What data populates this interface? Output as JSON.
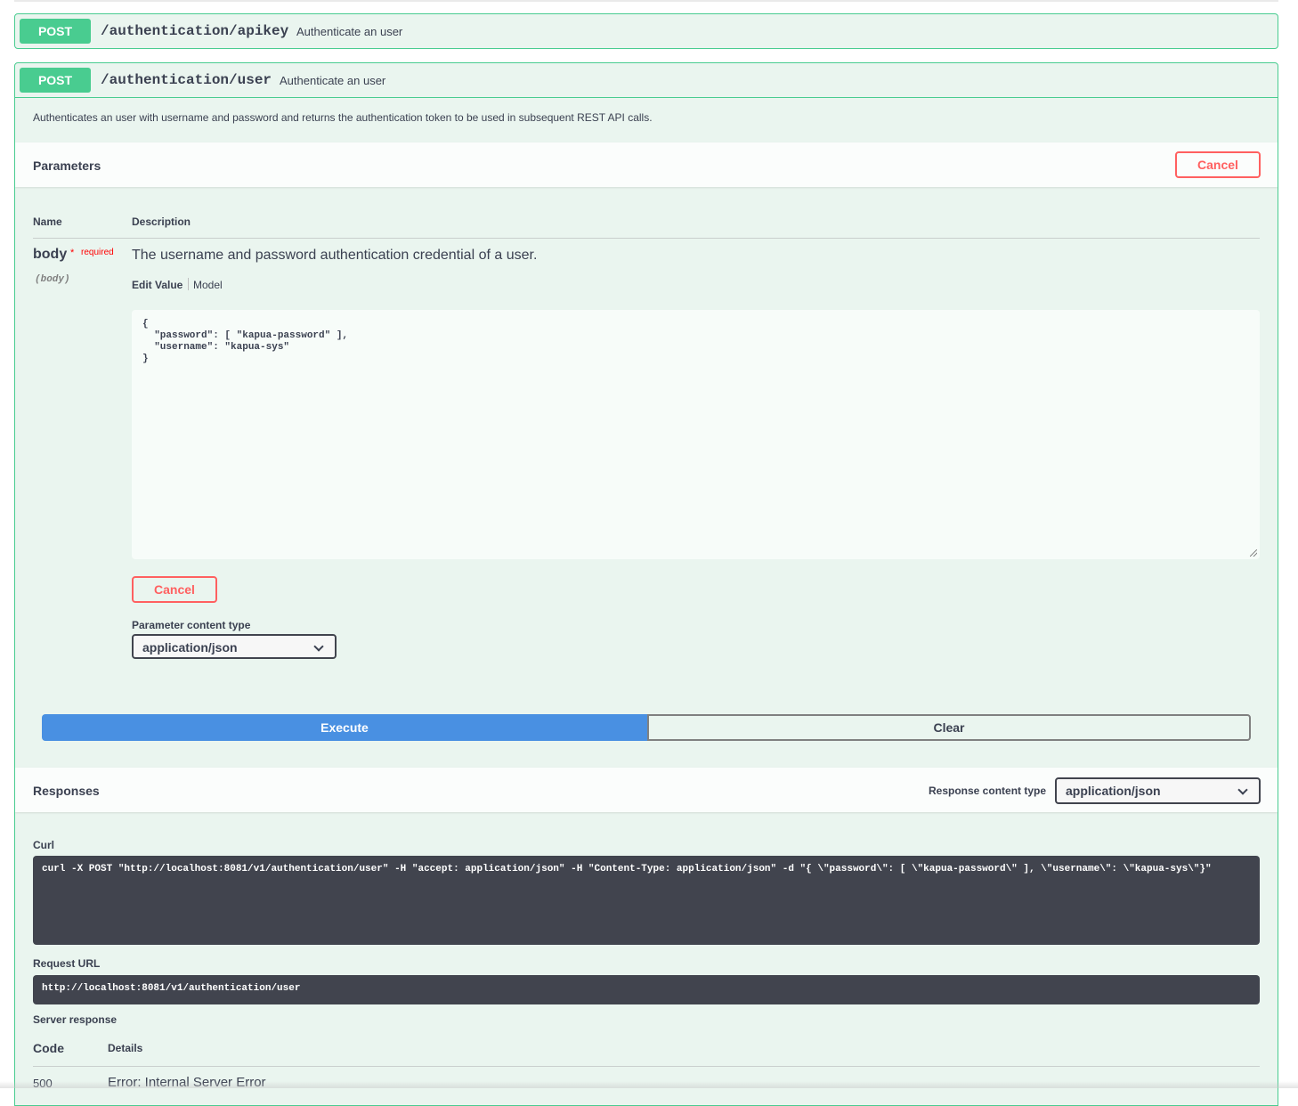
{
  "operations": [
    {
      "method": "POST",
      "path": "/authentication/apikey",
      "summary": "Authenticate an user"
    },
    {
      "method": "POST",
      "path": "/authentication/user",
      "summary": "Authenticate an user"
    }
  ],
  "expanded": {
    "description": "Authenticates an user with username and password and returns the authentication token to be used in subsequent REST API calls.",
    "parameters": {
      "title": "Parameters",
      "cancel_label": "Cancel",
      "col_name": "Name",
      "col_description": "Description",
      "param": {
        "name": "body",
        "required_mark": "*",
        "required_label": "required",
        "in": "(body)",
        "description": "The username and password authentication credential of a user.",
        "tab_edit": "Edit Value",
        "tab_model": "Model",
        "value": "{\n  \"password\": [ \"kapua-password\" ],\n  \"username\": \"kapua-sys\"\n}"
      },
      "cancel_label_2": "Cancel",
      "content_type_label": "Parameter content type",
      "content_type_value": "application/json"
    },
    "execute_label": "Execute",
    "clear_label": "Clear",
    "responses": {
      "title": "Responses",
      "content_type_label": "Response content type",
      "content_type_value": "application/json",
      "curl_label": "Curl",
      "curl_value": "curl -X POST \"http://localhost:8081/v1/authentication/user\" -H \"accept: application/json\" -H \"Content-Type: application/json\" -d \"{ \\\"password\\\": [ \\\"kapua-password\\\" ], \\\"username\\\": \\\"kapua-sys\\\"}\"",
      "request_url_label": "Request URL",
      "request_url_value": "http://localhost:8081/v1/authentication/user",
      "server_response_label": "Server response",
      "col_code": "Code",
      "col_details": "Details",
      "code": "500",
      "details": "Error: Internal Server Error"
    }
  },
  "colors": {
    "post": "#49cc90",
    "post_bg": "#eaf5ef",
    "execute": "#4990e2",
    "cancel": "#ff6060",
    "dark_block": "#41444e"
  }
}
